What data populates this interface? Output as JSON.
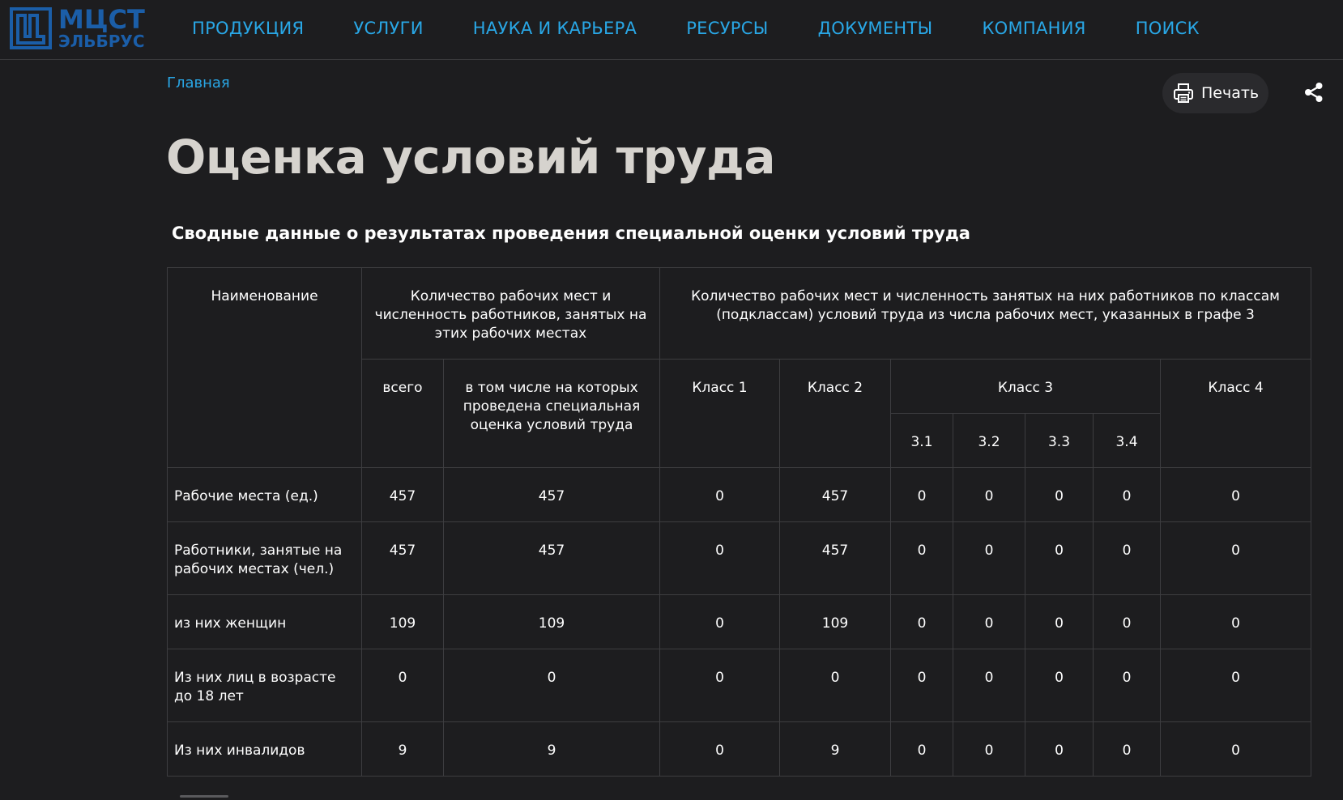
{
  "logo": {
    "line1": "МЦСТ",
    "line2": "ЭЛЬБРУС"
  },
  "nav": {
    "items": [
      {
        "label": "ПРОДУКЦИЯ"
      },
      {
        "label": "УСЛУГИ"
      },
      {
        "label": "НАУКА И КАРЬЕРА"
      },
      {
        "label": "РЕСУРСЫ"
      },
      {
        "label": "ДОКУМЕНТЫ"
      },
      {
        "label": "КОМПАНИЯ"
      },
      {
        "label": "ПОИСК"
      }
    ]
  },
  "breadcrumb": {
    "home": "Главная"
  },
  "actions": {
    "print_label": "Печать",
    "print_icon": "printer-icon",
    "share_icon": "share-icon"
  },
  "page": {
    "title": "Оценка условий труда",
    "subtitle": "Сводные данные о результатах проведения специальной оценки условий труда"
  },
  "table": {
    "headers": {
      "name": "Наименование",
      "count_group": "Количество рабочих мест и численность работников, занятых на этих рабочих местах",
      "class_group": "Количество рабочих мест и численность занятых на них работников по классам (подклассам) условий труда из числа рабочих мест, указанных в графе 3",
      "total": "всего",
      "assessed": "в том числе на которых проведена специальная оценка условий труда",
      "class1": "Класс 1",
      "class2": "Класс 2",
      "class3": "Класс 3",
      "class4": "Класс 4",
      "sub31": "3.1",
      "sub32": "3.2",
      "sub33": "3.3",
      "sub34": "3.4"
    },
    "rows": [
      {
        "name": "Рабочие места (ед.)",
        "values": [
          "457",
          "457",
          "0",
          "457",
          "0",
          "0",
          "0",
          "0",
          "0"
        ]
      },
      {
        "name": "Работники, занятые на рабочих местах (чел.)",
        "values": [
          "457",
          "457",
          "0",
          "457",
          "0",
          "0",
          "0",
          "0",
          "0"
        ]
      },
      {
        "name": "из них женщин",
        "values": [
          "109",
          "109",
          "0",
          "109",
          "0",
          "0",
          "0",
          "0",
          "0"
        ]
      },
      {
        "name": "Из них лиц в возрасте до 18 лет",
        "values": [
          "0",
          "0",
          "0",
          "0",
          "0",
          "0",
          "0",
          "0",
          "0"
        ]
      },
      {
        "name": "Из них инвалидов",
        "values": [
          "9",
          "9",
          "0",
          "9",
          "0",
          "0",
          "0",
          "0",
          "0"
        ]
      }
    ]
  },
  "colors": {
    "background": "#1d1d1f",
    "accent": "#29a7e6",
    "brand": "#1b5ea8",
    "title": "#d6d3ce"
  }
}
